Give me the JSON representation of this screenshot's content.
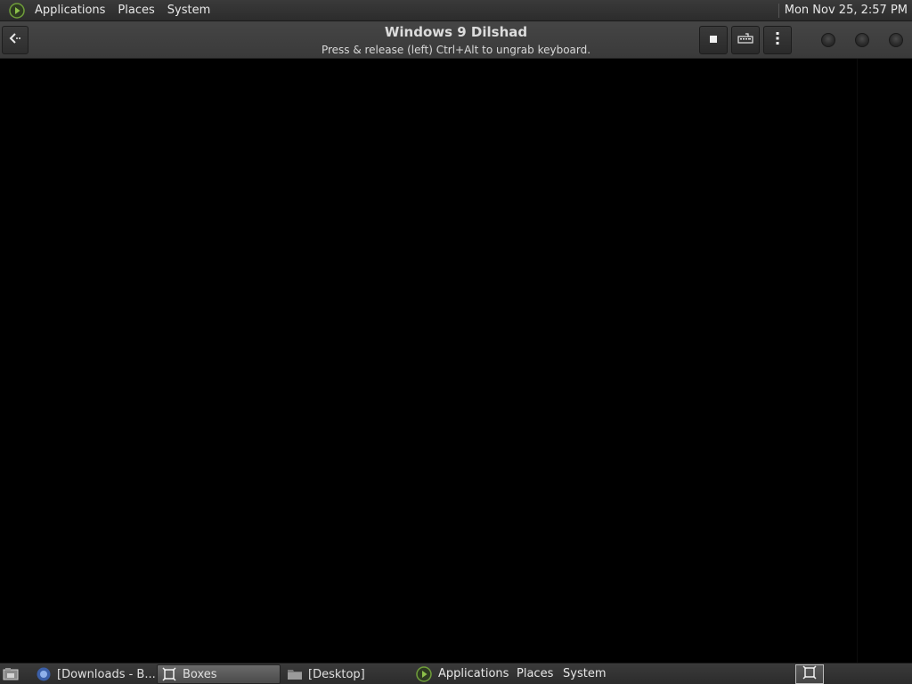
{
  "top_panel": {
    "menu_icon": "distro-logo-icon",
    "menus": [
      "Applications",
      "Places",
      "System"
    ],
    "clock": "Mon Nov 25,  2:57 PM"
  },
  "header": {
    "title": "Windows 9  Dilshad",
    "subtitle": "Press & release (left) Ctrl+Alt to ungrab keyboard.",
    "back_icon": "back-arrow-icon",
    "buttons": [
      "stop-icon",
      "keyboard-icon",
      "more-vertical-icon"
    ],
    "window_controls": [
      "minimize",
      "maximize",
      "close"
    ]
  },
  "taskbar": {
    "show_desktop_icon": "show-desktop-icon",
    "tasks": [
      {
        "label": "[Downloads - B...",
        "icon": "browser-icon"
      },
      {
        "label": "Boxes",
        "icon": "boxes-icon"
      },
      {
        "label": "[Desktop]",
        "icon": "folder-icon"
      }
    ],
    "menus": [
      "Applications",
      "Places",
      "System"
    ],
    "tray_icon": "boxes-tray-icon"
  },
  "colors": {
    "panel": "#333333",
    "vm_background": "#000000",
    "accent_green": "#6f9e3a"
  }
}
